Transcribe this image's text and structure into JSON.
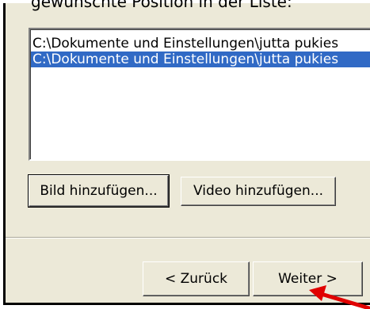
{
  "dialog": {
    "cut_off_label": "gewünschte Position in der Liste:"
  },
  "file_list": {
    "items": [
      "C:\\Dokumente und Einstellungen\\jutta pukies",
      "C:\\Dokumente und Einstellungen\\jutta pukies"
    ],
    "selected_index": 1
  },
  "buttons": {
    "add_image": "Bild hinzufügen...",
    "add_video": "Video hinzufügen...",
    "back": "< Zurück",
    "next": "Weiter >"
  },
  "colors": {
    "dialog_bg": "#ece9d8",
    "selection": "#316ac5",
    "annotation_arrow": "#e00000"
  },
  "icons": [
    "annotation-arrow-icon"
  ]
}
